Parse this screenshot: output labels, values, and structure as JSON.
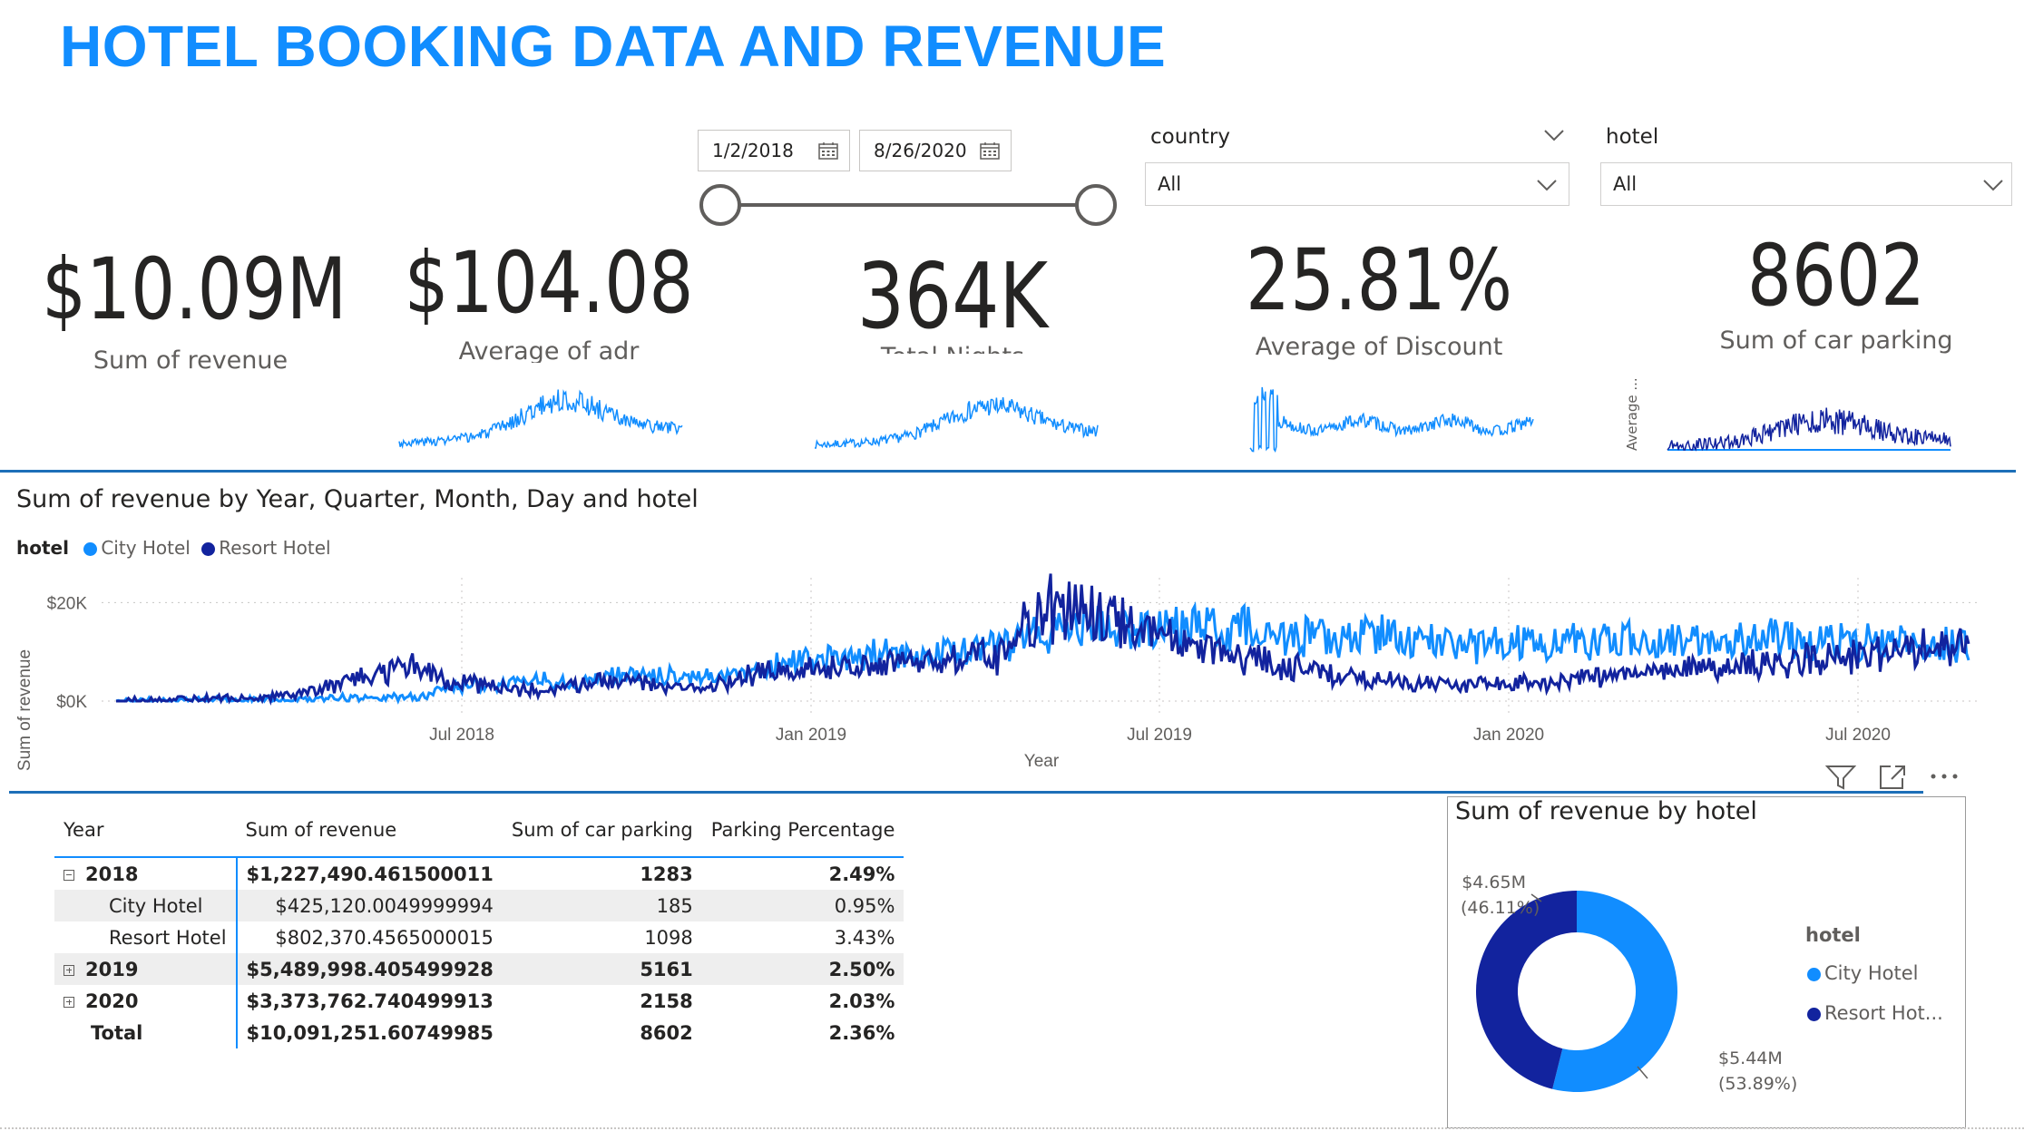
{
  "title": "HOTEL BOOKING DATA AND REVENUE",
  "date_slicer": {
    "start": "1/2/2018",
    "end": "8/26/2020"
  },
  "country_slicer": {
    "label": "country",
    "value": "All"
  },
  "hotel_slicer": {
    "label": "hotel",
    "value": "All"
  },
  "kpis": {
    "revenue": {
      "value": "$10.09M",
      "label": "Sum of revenue"
    },
    "adr": {
      "value": "$104.08",
      "label": "Average of adr"
    },
    "nights": {
      "value": "364K",
      "label": "Total Nights"
    },
    "discount": {
      "value": "25.81%",
      "label": "Average of Discount"
    },
    "parking": {
      "value": "8602",
      "label": "Sum of car parking"
    },
    "sparkline_axis": "Average ..."
  },
  "revenue_chart": {
    "title": "Sum of revenue by Year, Quarter, Month, Day and hotel",
    "legend_title": "hotel",
    "x_label": "Year",
    "y_label": "Sum of revenue"
  },
  "chart_data": {
    "type": "line",
    "x_ticks": [
      "Jul 2018",
      "Jan 2019",
      "Jul 2019",
      "Jan 2020",
      "Jul 2020"
    ],
    "y_ticks": [
      "$0K",
      "$20K"
    ],
    "ylim": [
      0,
      28000
    ],
    "grid": true,
    "legend_placement": "top-left",
    "series": [
      {
        "name": "City Hotel",
        "color": "#118DFF",
        "values": [
          0,
          0,
          100,
          200,
          200,
          300,
          300,
          500,
          700,
          800,
          700,
          3000,
          3500,
          4000,
          4500,
          3500,
          5000,
          5500,
          5500,
          5000,
          5500,
          6000,
          8000,
          8500,
          8500,
          9500,
          9000,
          10000,
          10500,
          11000,
          12500,
          14000,
          15000,
          14500,
          15000,
          15500,
          15000,
          15500,
          12500,
          13000,
          12500,
          13000,
          13500,
          12000,
          12000,
          11500,
          11500,
          11500,
          12000,
          12000,
          12500,
          12000,
          12000,
          12500,
          13000,
          12500,
          12000,
          12000,
          12000,
          11500,
          11000,
          11500
        ]
      },
      {
        "name": "Resort Hotel",
        "color": "#12239E",
        "values": [
          100,
          200,
          300,
          500,
          500,
          800,
          1200,
          3000,
          5000,
          6500,
          7000,
          4000,
          3500,
          2000,
          2500,
          3000,
          4000,
          4500,
          3000,
          3000,
          3500,
          5500,
          6000,
          6500,
          6500,
          7000,
          7500,
          8000,
          8500,
          9000,
          17000,
          19000,
          18000,
          16000,
          13500,
          11500,
          10500,
          9000,
          8000,
          7000,
          5500,
          4500,
          4000,
          3500,
          3500,
          3500,
          3500,
          3500,
          4500,
          5500,
          5500,
          6000,
          6500,
          7000,
          7500,
          8000,
          8500,
          9000,
          10000,
          10500,
          11000,
          11500
        ]
      }
    ]
  },
  "table": {
    "headers": [
      "Year",
      "Sum of revenue",
      "Sum of car parking",
      "Parking Percentage"
    ],
    "rows": [
      {
        "label": "2018",
        "revenue": "$1,227,490.461500011",
        "parking": "1283",
        "pct": "2.49%"
      },
      {
        "label": "City Hotel",
        "revenue": "$425,120.0049999994",
        "parking": "185",
        "pct": "0.95%"
      },
      {
        "label": "Resort Hotel",
        "revenue": "$802,370.4565000015",
        "parking": "1098",
        "pct": "3.43%"
      },
      {
        "label": "2019",
        "revenue": "$5,489,998.405499928",
        "parking": "5161",
        "pct": "2.50%"
      },
      {
        "label": "2020",
        "revenue": "$3,373,762.740499913",
        "parking": "2158",
        "pct": "2.03%"
      },
      {
        "label": "Total",
        "revenue": "$10,091,251.60749985",
        "parking": "8602",
        "pct": "2.36%"
      }
    ]
  },
  "donut": {
    "title": "Sum of revenue by hotel",
    "legend_title": "hotel",
    "legend": [
      "City Hotel",
      "Resort Hot..."
    ],
    "labels": {
      "resort_value": "$4.65M",
      "resort_pct": "(46.11%)",
      "city_value": "$5.44M",
      "city_pct": "(53.89%)"
    },
    "slices": [
      {
        "name": "City Hotel",
        "value": 5.44,
        "percent": 53.89,
        "color": "#118DFF"
      },
      {
        "name": "Resort Hotel",
        "value": 4.65,
        "percent": 46.11,
        "color": "#12239E"
      }
    ]
  },
  "colors": {
    "accent": "#118DFF",
    "dark": "#12239E",
    "divider": "#1d6fb8"
  }
}
